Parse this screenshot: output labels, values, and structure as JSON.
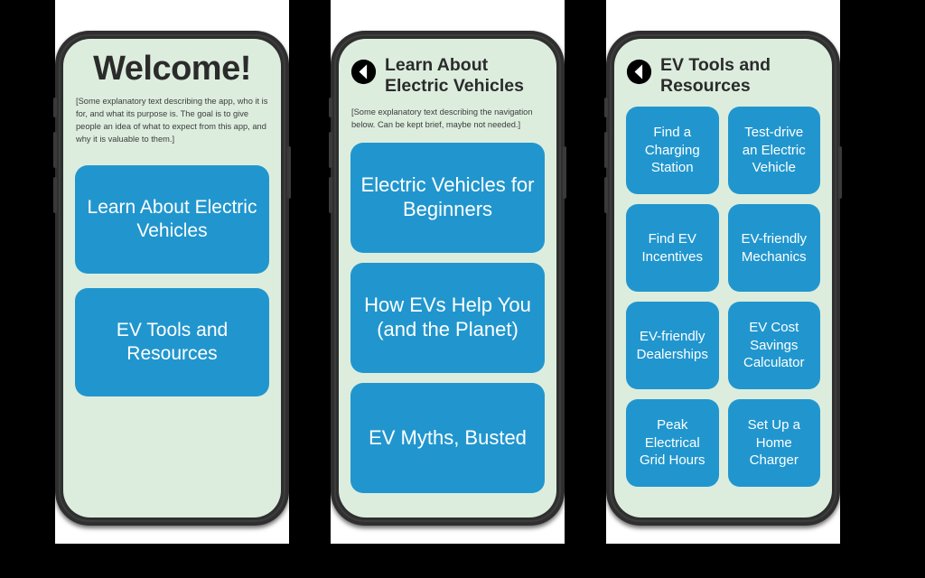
{
  "theme": {
    "background": "#000000",
    "panel": "#ffffff",
    "device_frame": "#2f2f2f",
    "screen": "#dcedde",
    "accent_blue": "#2196ce",
    "text_dark": "#2b2b2b",
    "text_body": "#3c3c3c",
    "tile_label": "#ffffff"
  },
  "screens": [
    {
      "name": "welcome",
      "title": "Welcome!",
      "body": "[Some explanatory text describing the app, who it is for, and what its purpose is. The goal is to give people an idea of what to expect from this app, and why it is valuable to them.]",
      "buttons": [
        {
          "label": "Learn About Electric Vehicles"
        },
        {
          "label": "EV Tools and Resources"
        }
      ]
    },
    {
      "name": "learn-about-electric-vehicles",
      "back_icon": "back-arrow-circle-icon",
      "title": "Learn About Electric Vehicles",
      "body": "[Some explanatory text describing the navigation below. Can be kept brief, maybe not needed.]",
      "buttons": [
        {
          "label": "Electric Vehicles for Beginners"
        },
        {
          "label": "How EVs Help You (and the Planet)"
        },
        {
          "label": "EV Myths, Busted"
        }
      ]
    },
    {
      "name": "ev-tools-and-resources",
      "back_icon": "back-arrow-circle-icon",
      "title": "EV Tools and Resources",
      "tiles": [
        {
          "label": "Find a Charging Station"
        },
        {
          "label": "Test-drive an Electric Vehicle"
        },
        {
          "label": "Find EV Incentives"
        },
        {
          "label": "EV-friendly Mechanics"
        },
        {
          "label": "EV-friendly Dealerships"
        },
        {
          "label": "EV Cost Savings Calculator"
        },
        {
          "label": "Peak Electrical Grid Hours"
        },
        {
          "label": "Set Up a Home Charger"
        }
      ]
    }
  ]
}
